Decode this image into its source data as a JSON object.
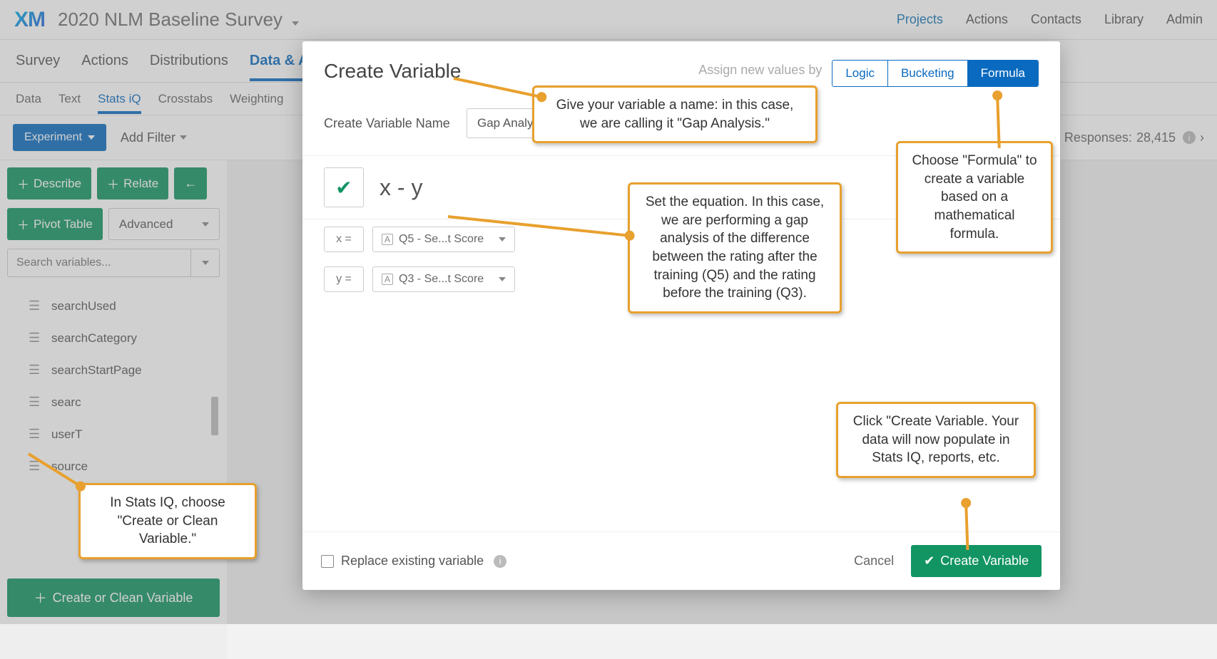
{
  "logo": "XM",
  "project_title": "2020 NLM Baseline Survey",
  "topnav": {
    "projects": "Projects",
    "actions": "Actions",
    "contacts": "Contacts",
    "library": "Library",
    "admin": "Admin"
  },
  "tabs1": {
    "survey": "Survey",
    "actions": "Actions",
    "distributions": "Distributions",
    "data": "Data & A"
  },
  "tabs2": {
    "data": "Data",
    "text": "Text",
    "stats": "Stats iQ",
    "crosstabs": "Crosstabs",
    "weighting": "Weighting"
  },
  "toolbar": {
    "experiment": "Experiment",
    "add_filter": "Add Filter",
    "responses_label": "Responses:",
    "responses_value": "28,415"
  },
  "sidebar": {
    "describe": "Describe",
    "relate": "Relate",
    "pivot": "Pivot Table",
    "advanced": "Advanced",
    "search_placeholder": "Search variables...",
    "vars": [
      "searchUsed",
      "searchCategory",
      "searchStartPage",
      "searc",
      "userT",
      "source"
    ],
    "create_clean": "Create or Clean Variable"
  },
  "modal": {
    "title": "Create Variable",
    "assign_by": "Assign new values by",
    "seg": {
      "logic": "Logic",
      "bucketing": "Bucketing",
      "formula": "Formula"
    },
    "name_label": "Create Variable Name",
    "name_value": "Gap Analysis",
    "formula": "x - y",
    "x_label": "x =",
    "y_label": "y =",
    "x_value": "Q5 - Se...t Score",
    "y_value": "Q3 - Se...t Score",
    "replace_label": "Replace existing variable",
    "cancel": "Cancel",
    "create": "Create Variable"
  },
  "callouts": {
    "name": "Give your variable a name: in this case, we are calling it \"Gap Analysis.\"",
    "formula_choose": "Choose \"Formula\" to create a variable based on a mathematical formula.",
    "equation": "Set the equation. In this case, we are performing a gap analysis of the difference between the rating after the training (Q5) and the rating before the training (Q3).",
    "create_click": "Click \"Create Variable. Your data will now populate in Stats IQ, reports, etc.",
    "stats_iq": "In Stats IQ, choose \"Create or Clean Variable.\""
  }
}
